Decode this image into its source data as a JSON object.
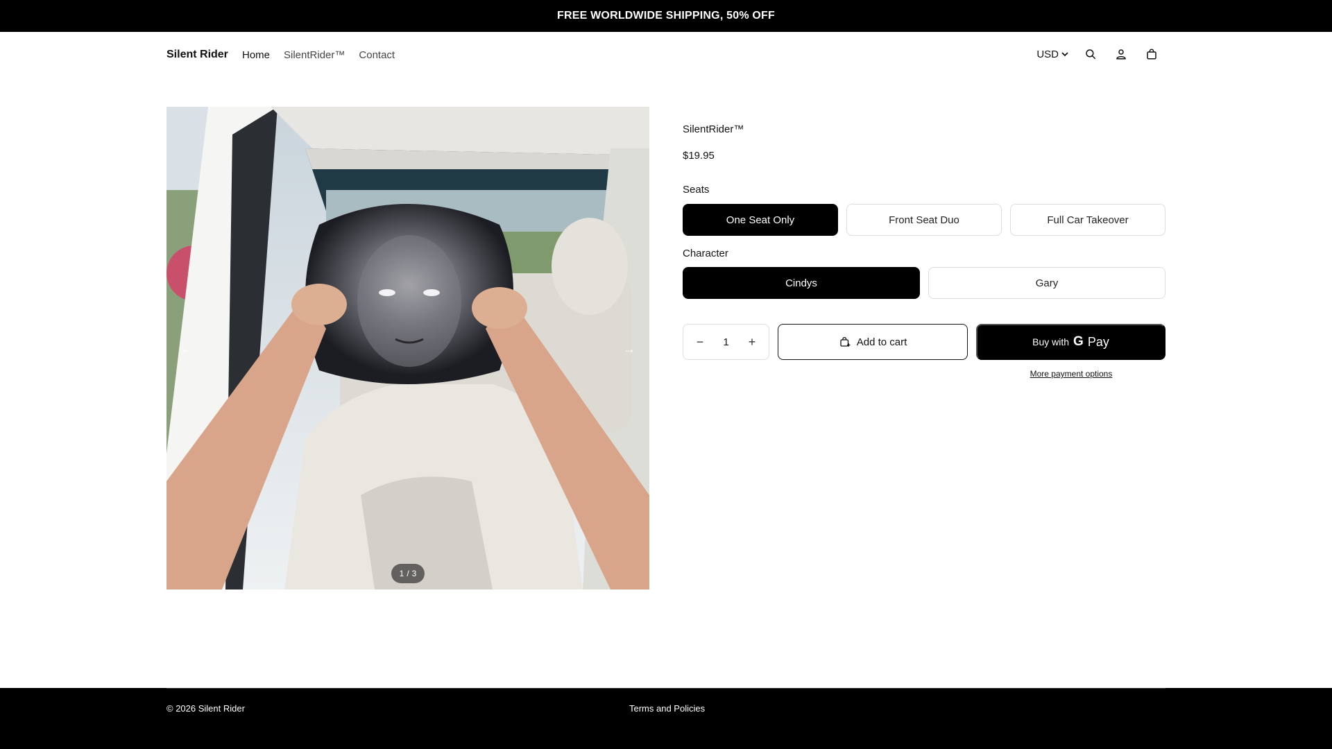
{
  "announcement": "FREE WORLDWIDE SHIPPING, 50% OFF",
  "header": {
    "logo": "Silent Rider",
    "nav": [
      "Home",
      "SilentRider™",
      "Contact"
    ],
    "currency": "USD",
    "icons": [
      "search-icon",
      "account-icon",
      "cart-icon"
    ]
  },
  "gallery": {
    "current": "1",
    "separator": "/",
    "total": "3",
    "prev_icon": "←",
    "next_icon": "→"
  },
  "product": {
    "title": "SilentRider™",
    "price": "$19.95",
    "seats_label": "Seats",
    "seats": [
      "One Seat Only",
      "Front Seat Duo",
      "Full Car Takeover"
    ],
    "seats_selected": "One Seat Only",
    "character_label": "Character",
    "characters": [
      "Cindys",
      "Gary"
    ],
    "character_selected": "Cindys",
    "quantity": "1",
    "minus": "−",
    "plus": "+",
    "add_to_cart": "Add to cart",
    "buy_with": "Buy with",
    "gpay_g": "G",
    "gpay_pay": "Pay",
    "more_payment": "More payment options"
  },
  "footer": {
    "copyright": "© 2026 Silent Rider",
    "terms": "Terms and Policies"
  },
  "colors": {
    "primary": "#000000",
    "background": "#ffffff",
    "border": "#dddddd"
  }
}
